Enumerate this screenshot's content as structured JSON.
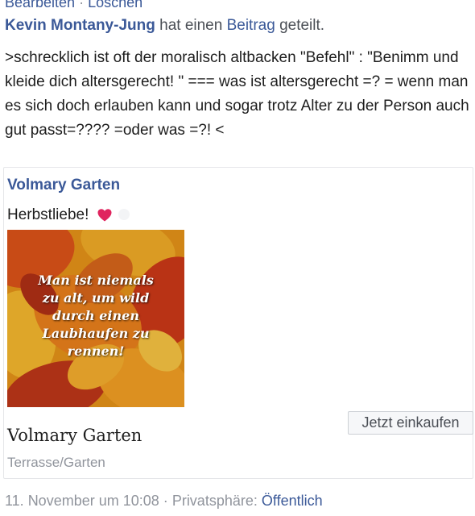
{
  "top_actions": {
    "edit": "Bearbeiten",
    "separator": "·",
    "delete": "Löschen"
  },
  "shared": {
    "author": "Kevin Montany-Jung",
    "text_before": "hat einen",
    "link": "Beitrag",
    "text_after": "geteilt."
  },
  "post": {
    "text": ">schrecklich ist oft der moralisch altbacken \"Befehl\" : \"Benimm und kleide dich altersgerecht! \" === was ist altersgerecht =? = wenn man es sich doch erlauben kann und sogar trotz Alter zu der Person auch gut passt=???? =oder was =?! <"
  },
  "shared_post": {
    "page_name": "Volmary Garten",
    "text": "Herbstliebe!",
    "emoji_icon": "red-heart-icon",
    "image_caption_lines": [
      "Man ist niemals",
      "zu alt, um wild",
      "durch einen",
      "Laubhaufen zu",
      "rennen!"
    ]
  },
  "store": {
    "name": "Volmary Garten",
    "category": "Terrasse/Garten",
    "shop_button": "Jetzt einkaufen"
  },
  "meta": {
    "timestamp": "11. November um 10:08",
    "separator": "·",
    "privacy_label": "Privatsphäre:",
    "privacy_value": "Öffentlich"
  },
  "colors": {
    "link": "#3b5998",
    "secondary_text": "#90949c",
    "heart": "#e0245e"
  }
}
